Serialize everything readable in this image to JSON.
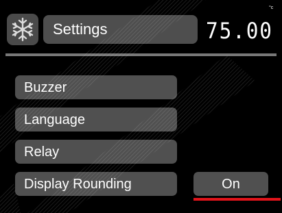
{
  "header": {
    "icon": "snowflake-icon",
    "title": "Settings",
    "temperature": "75.00",
    "unit": "°c"
  },
  "menu": {
    "items": [
      {
        "label": "Buzzer"
      },
      {
        "label": "Language"
      },
      {
        "label": "Relay"
      },
      {
        "label": "Display Rounding"
      }
    ],
    "selected_value": "On"
  },
  "colors": {
    "background": "#000000",
    "panel": "#505050",
    "accent": "#e3141b"
  }
}
